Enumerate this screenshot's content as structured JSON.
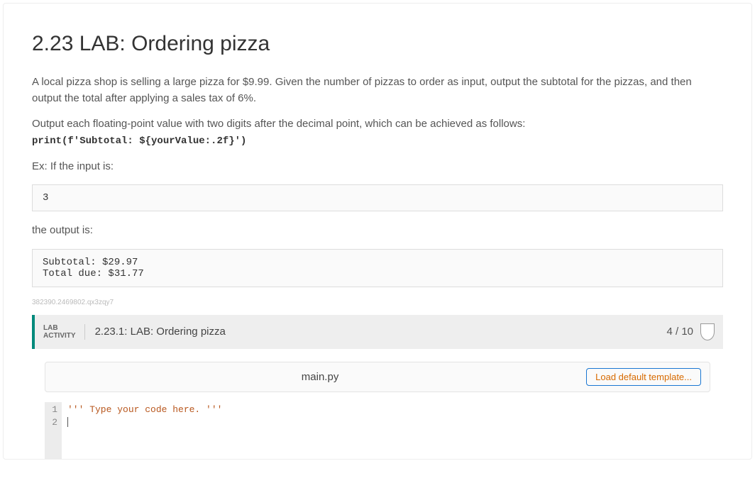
{
  "page_title": "2.23 LAB: Ordering pizza",
  "description_p1": "A local pizza shop is selling a large pizza for $9.99. Given the number of pizzas to order as input, output the subtotal for the pizzas, and then output the total after applying a sales tax of 6%.",
  "description_p2_prefix": "Output each floating-point value with two digits after the decimal point, which can be achieved as follows:",
  "code_hint": "print(f'Subtotal: ${yourValue:.2f}')",
  "example_intro": "Ex: If the input is:",
  "example_input": "3",
  "output_intro": "the output is:",
  "example_output": "Subtotal: $29.97\nTotal due: $31.77",
  "question_id": "382390.2469802.qx3zqy7",
  "activity": {
    "tag_line1": "LAB",
    "tag_line2": "ACTIVITY",
    "title": "2.23.1: LAB: Ordering pizza",
    "score": "4 / 10"
  },
  "editor": {
    "filename": "main.py",
    "load_template_label": "Load default template...",
    "gutter": {
      "l1": "1",
      "l2": "2"
    },
    "line1": "''' Type your code here. '''"
  }
}
